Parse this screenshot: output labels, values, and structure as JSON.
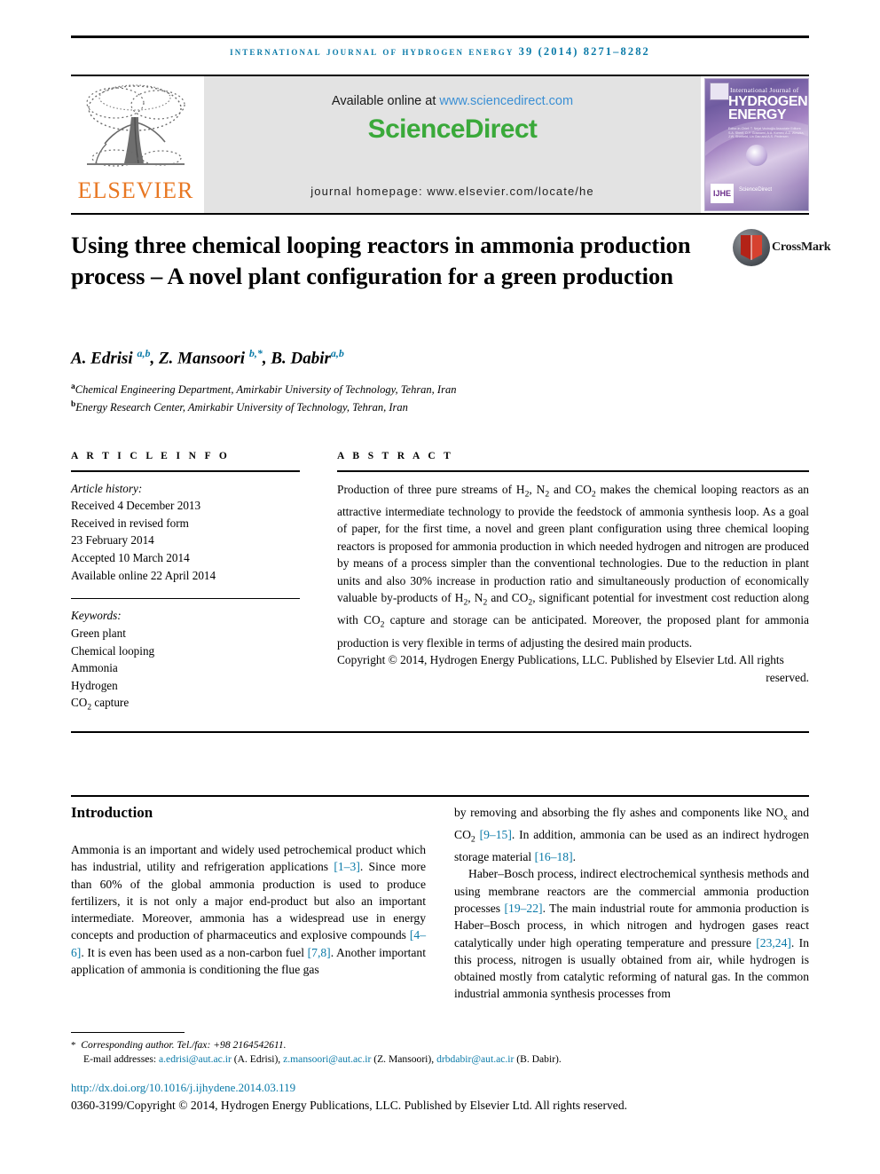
{
  "running_head": "International Journal of Hydrogen Energy 39 (2014) 8271–8282",
  "masthead": {
    "available_prefix": "Available online at ",
    "available_url": "www.sciencedirect.com",
    "sciencedirect_logo": "ScienceDirect",
    "journal_homepage": "journal homepage: www.elsevier.com/locate/he",
    "publisher_wordmark": "ELSEVIER",
    "cover": {
      "line_small": "International Journal of",
      "line_big_1": "HYDROGEN",
      "line_big_2": "ENERGY",
      "editors": "Editor-in-Chief: T. Nejat Veziroğlu   Associate Editors: S.A. Sherif, D.Y. Goswami, A.A. Kornev, A.Z. Weszka, J.W. Sheffield, Lin Gao and A.S. Pedersen",
      "mark": "IJHE",
      "sciencedirect_tag": "ScienceDirect"
    }
  },
  "article": {
    "title": "Using three chemical looping reactors in ammonia production process – A novel plant configuration for a green production",
    "crossmark_label": "CrossMark",
    "authors_html": "A. Edrisi <sup>a,b</sup>, Z. Mansoori <sup>b,*</sup>, B. Dabir<sup>a,b</sup>",
    "affiliations": [
      {
        "marker": "a",
        "text": "Chemical Engineering Department, Amirkabir University of Technology, Tehran, Iran"
      },
      {
        "marker": "b",
        "text": "Energy Research Center, Amirkabir University of Technology, Tehran, Iran"
      }
    ]
  },
  "article_info": {
    "heading": "A R T I C L E   I N F O",
    "history_label": "Article history:",
    "history": [
      "Received 4 December 2013",
      "Received in revised form",
      "23 February 2014",
      "Accepted 10 March 2014",
      "Available online 22 April 2014"
    ],
    "keywords_label": "Keywords:",
    "keywords_html": "Green plant<br>Chemical looping<br>Ammonia<br>Hydrogen<br>CO<sub>2</sub> capture"
  },
  "abstract": {
    "heading": "A B S T R A C T",
    "body_html": "Production of three pure streams of H<sub>2</sub>, N<sub>2</sub> and CO<sub>2</sub> makes the chemical looping reactors as an attractive intermediate technology to provide the feedstock of ammonia synthesis loop. As a goal of paper, for the first time, a novel and green plant configuration using three chemical looping reactors is proposed for ammonia production in which needed hydrogen and nitrogen are produced by means of a process simpler than the conventional technologies. Due to the reduction in plant units and also 30% increase in production ratio and simultaneously production of economically valuable by-products of H<sub>2</sub>, N<sub>2</sub> and CO<sub>2</sub>, significant potential for investment cost reduction along with CO<sub>2</sub> capture and storage can be anticipated. Moreover, the proposed plant for ammonia production is very flexible in terms of adjusting the desired main products.",
    "copyright_html": "Copyright © 2014, Hydrogen Energy Publications, LLC. Published by Elsevier Ltd. All rights<span class=\"tail\">reserved.</span>"
  },
  "introduction": {
    "heading": "Introduction",
    "left_paragraph_html": "Ammonia is an important and widely used petrochemical product which has industrial, utility and refrigeration applications <span class=\"ref\">[1–3]</span>. Since more than 60% of the global ammonia production is used to produce fertilizers, it is not only a major end-product but also an important intermediate. Moreover, ammonia has a widespread use in energy concepts and production of pharmaceutics and explosive compounds <span class=\"ref\">[4–6]</span>. It is even has been used as a non-carbon fuel <span class=\"ref\">[7,8]</span>. Another important application of ammonia is conditioning the flue gas",
    "right_paragraph_1_html": "by removing and absorbing the fly ashes and components like NO<sub>x</sub> and CO<sub>2</sub> <span class=\"ref\">[9–15]</span>. In addition, ammonia can be used as an indirect hydrogen storage material <span class=\"ref\">[16–18]</span>.",
    "right_paragraph_2_html": "Haber–Bosch process, indirect electrochemical synthesis methods and using membrane reactors are the commercial ammonia production processes <span class=\"ref\">[19–22]</span>. The main industrial route for ammonia production is Haber–Bosch process, in which nitrogen and hydrogen gases react catalytically under high operating temperature and pressure <span class=\"ref\">[23,24]</span>. In this process, nitrogen is usually obtained from air, while hydrogen is obtained mostly from catalytic reforming of natural gas. In the common industrial ammonia synthesis processes from"
  },
  "footnotes": {
    "corresponding_html": "<span class=\"star\">*</span> &nbsp;<span class=\"ital\">Corresponding author. Tel./fax: +98 2164542611.</span>",
    "emails_html": "E-mail addresses: <span class=\"mail\">a.edrisi@aut.ac.ir</span> (A. Edrisi), <span class=\"mail\">z.mansoori@aut.ac.ir</span> (Z. Mansoori), <span class=\"mail\">drbdabir@aut.ac.ir</span> (B. Dabir).",
    "doi": "http://dx.doi.org/10.1016/j.ijhydene.2014.03.119",
    "issn_line": "0360-3199/Copyright © 2014, Hydrogen Energy Publications, LLC. Published by Elsevier Ltd. All rights reserved."
  },
  "colors": {
    "link_teal": "#0a7aa8",
    "sciencedirect_green": "#3aa93a",
    "elsevier_orange": "#e87722",
    "url_blue": "#3b8fd4"
  }
}
